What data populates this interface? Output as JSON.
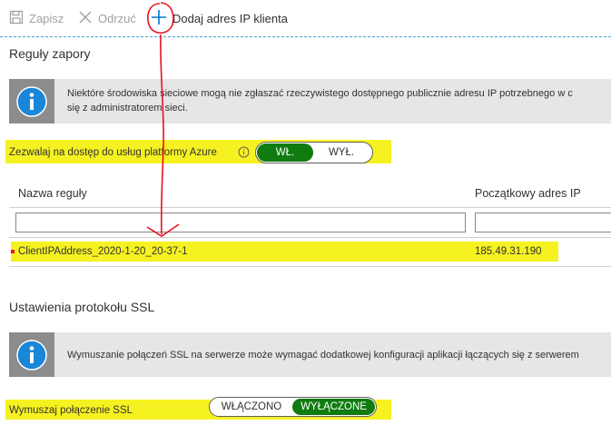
{
  "toolbar": {
    "save_label": "Zapisz",
    "discard_label": "Odrzuć",
    "add_client_ip_label": "Dodaj adres IP klienta"
  },
  "firewall": {
    "title": "Reguły zapory",
    "info_line1": "Niektóre środowiska sieciowe mogą nie zgłaszać rzeczywistego dostępnego publicznie adresu IP potrzebnego w c",
    "info_line2": "się z administratorem sieci.",
    "allow_azure_label": "Zezwalaj na dostęp do usług platformy Azure",
    "toggle_on": "WŁ.",
    "toggle_off": "WYŁ.",
    "allow_azure_state": "on",
    "columns": [
      "Nazwa reguły",
      "Początkowy adres IP"
    ],
    "rows": [
      {
        "name": "ClientIPAddress_2020-1-20_20-37-1",
        "start_ip": "185.49.31.190"
      }
    ]
  },
  "ssl": {
    "title": "Ustawienia protokołu SSL",
    "info_text": "Wymuszanie połączeń SSL na serwerze może wymagać dodatkowej konfiguracji aplikacji łączących się z serwerem",
    "enforce_label": "Wymuszaj połączenie SSL",
    "toggle_enabled": "WŁĄCZONO",
    "toggle_disabled": "WYŁĄCZONE",
    "enforce_state": "disabled"
  },
  "colors": {
    "accent": "#0078d4",
    "toggle_active": "#107c10",
    "highlight": "#f6f221",
    "annotation": "#e81123"
  }
}
